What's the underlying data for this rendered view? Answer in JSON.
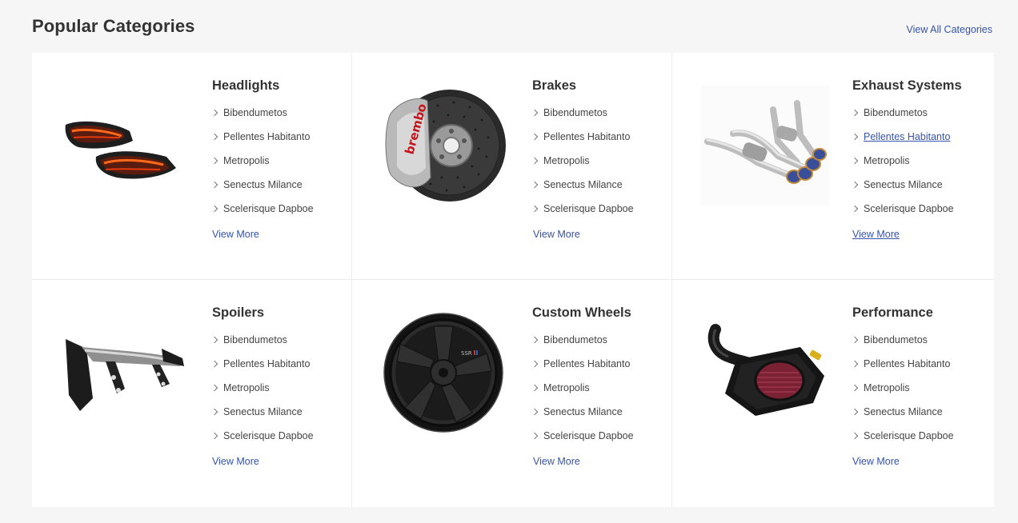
{
  "header": {
    "title": "Popular Categories",
    "view_all": "View All Categories"
  },
  "categories": [
    {
      "title": "Headlights",
      "image": "headlights-image",
      "items": [
        "Bibendumetos",
        "Pellentes Habitanto",
        "Metropolis",
        "Senectus Milance",
        "Scelerisque Dapboe"
      ],
      "more": "View More"
    },
    {
      "title": "Brakes",
      "image": "brakes-image",
      "items": [
        "Bibendumetos",
        "Pellentes Habitanto",
        "Metropolis",
        "Senectus Milance",
        "Scelerisque Dapboe"
      ],
      "more": "View More"
    },
    {
      "title": "Exhaust Systems",
      "image": "exhaust-image",
      "items": [
        "Bibendumetos",
        "Pellentes Habitanto",
        "Metropolis",
        "Senectus Milance",
        "Scelerisque Dapboe"
      ],
      "more": "View More"
    },
    {
      "title": "Spoilers",
      "image": "spoiler-image",
      "items": [
        "Bibendumetos",
        "Pellentes Habitanto",
        "Metropolis",
        "Senectus Milance",
        "Scelerisque Dapboe"
      ],
      "more": "View More"
    },
    {
      "title": "Custom Wheels",
      "image": "wheel-image",
      "items": [
        "Bibendumetos",
        "Pellentes Habitanto",
        "Metropolis",
        "Senectus Milance",
        "Scelerisque Dapboe"
      ],
      "more": "View More"
    },
    {
      "title": "Performance",
      "image": "air-intake-image",
      "items": [
        "Bibendumetos",
        "Pellentes Habitanto",
        "Metropolis",
        "Senectus Milance",
        "Scelerisque Dapboe"
      ],
      "more": "View More"
    }
  ],
  "colors": {
    "link": "#3654a8",
    "text": "#333333",
    "background": "#f6f6f6"
  }
}
